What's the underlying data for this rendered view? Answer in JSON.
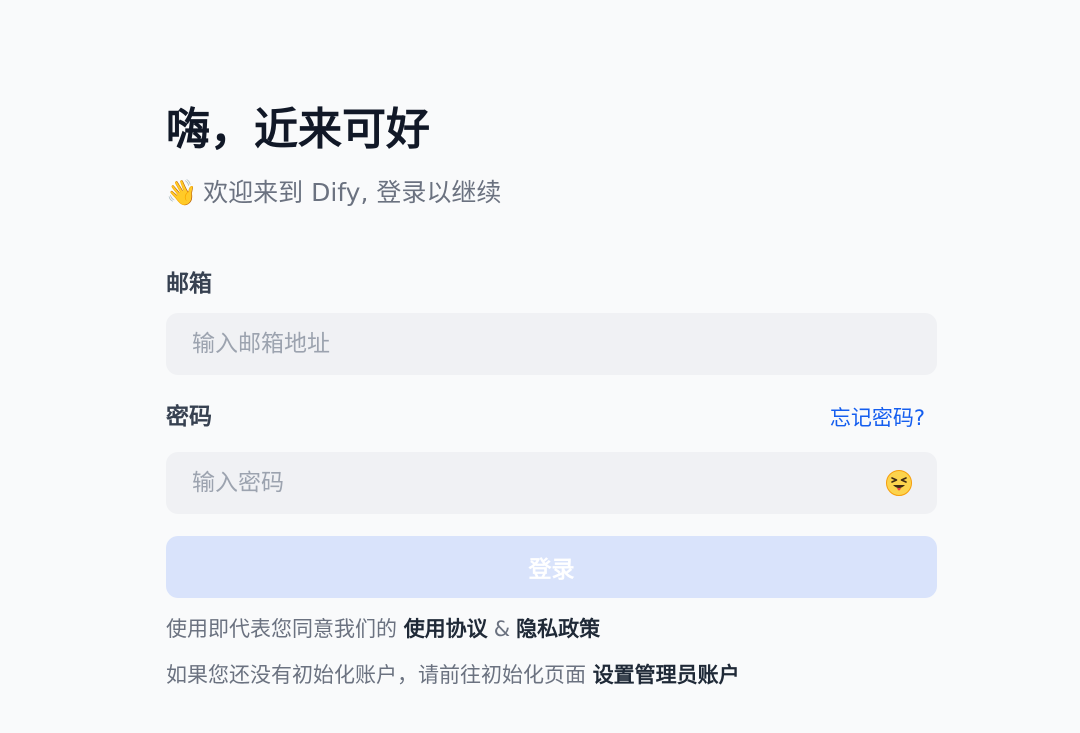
{
  "header": {
    "title": "嗨，近来可好",
    "wave_emoji": "👋",
    "subtitle": "欢迎来到 Dify, 登录以继续"
  },
  "email": {
    "label": "邮箱",
    "placeholder": "输入邮箱地址",
    "value": ""
  },
  "password": {
    "label": "密码",
    "forgot_label": "忘记密码?",
    "placeholder": "输入密码",
    "value": "",
    "toggle_icon": "eye-hidden-icon"
  },
  "login": {
    "label": "登录",
    "disabled": true
  },
  "terms": {
    "prefix": "使用即代表您同意我们的",
    "terms_link": "使用协议",
    "amp": "&",
    "privacy_link": "隐私政策"
  },
  "init": {
    "prefix": "如果您还没有初始化账户，请前往初始化页面",
    "link": "设置管理员账户"
  },
  "colors": {
    "accent": "#155eef",
    "button_disabled": "#d9e3fb",
    "input_bg": "#f0f1f4",
    "page_bg": "#f9fafb"
  }
}
